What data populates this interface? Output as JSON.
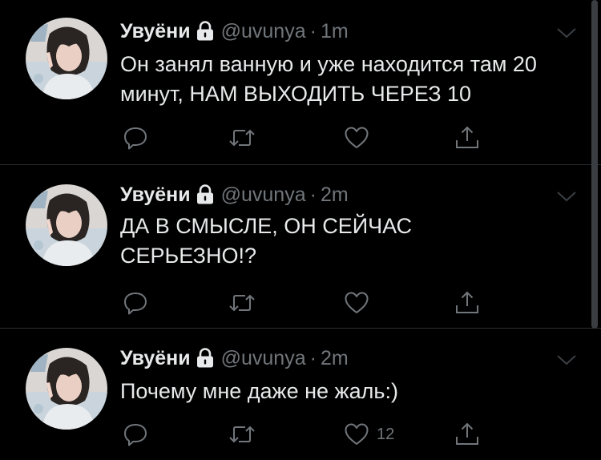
{
  "tweets": [
    {
      "display_name": "Увуёни",
      "handle": "@uvunya",
      "separator": "·",
      "time": "1m",
      "text": "Он занял ванную и уже находится там 20 минут, НАМ ВЫХОДИТЬ ЧЕРЕЗ 10",
      "like_count": ""
    },
    {
      "display_name": "Увуёни",
      "handle": "@uvunya",
      "separator": "·",
      "time": "2m",
      "text": "ДА В СМЫСЛЕ, ОН СЕЙЧАС СЕРЬЕЗНО!?",
      "like_count": ""
    },
    {
      "display_name": "Увуёни",
      "handle": "@uvunya",
      "separator": "·",
      "time": "2m",
      "text": "Почему мне даже не жаль:)",
      "like_count": "12"
    }
  ],
  "icons": {
    "lock": "lock-icon",
    "caret": "chevron-down-icon",
    "reply": "reply-icon",
    "retweet": "retweet-icon",
    "like": "heart-icon",
    "share": "share-icon"
  },
  "colors": {
    "background": "#000000",
    "text": "#e7e9ea",
    "secondary": "#71767b",
    "divider": "#2a2d31"
  }
}
